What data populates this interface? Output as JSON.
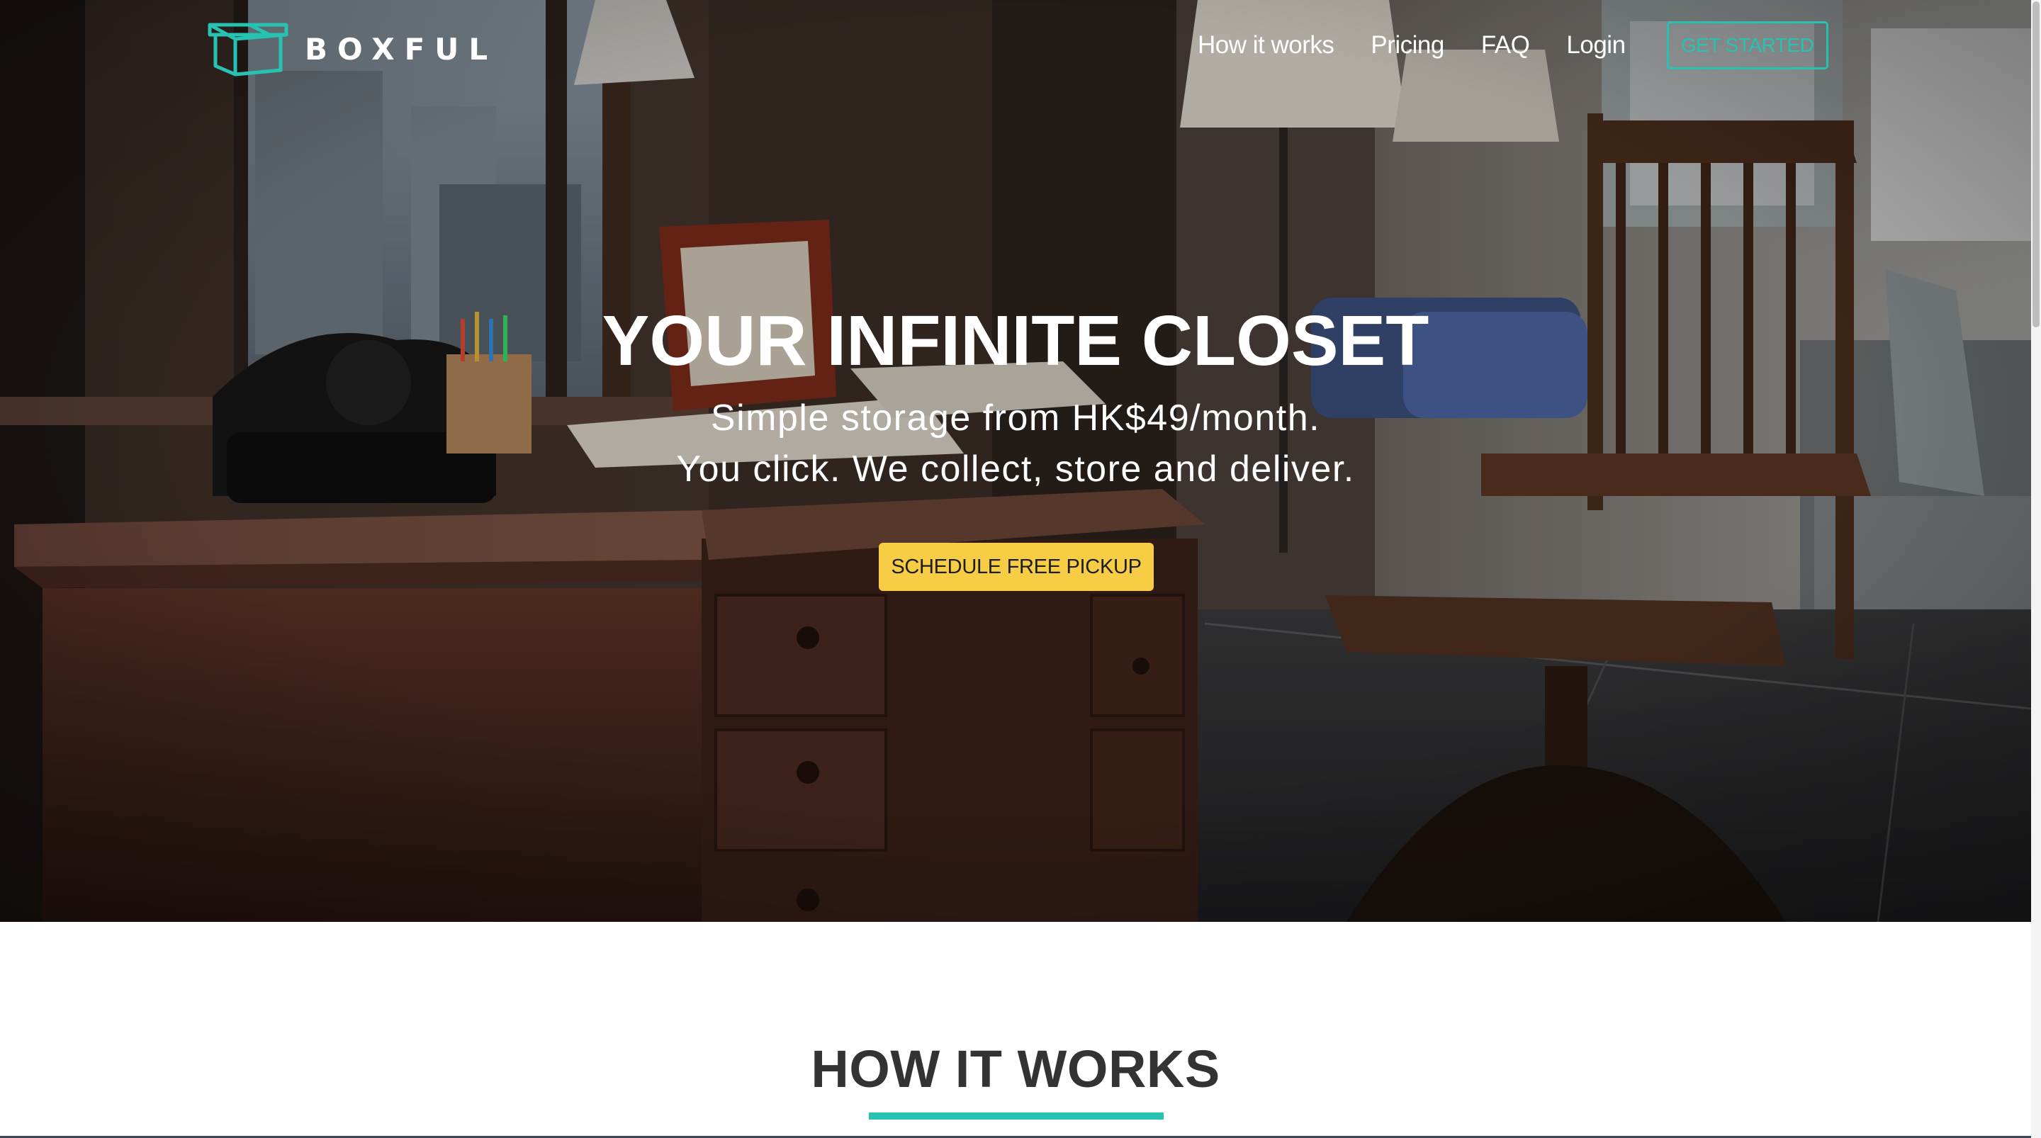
{
  "brand": {
    "name": "BOXFUL",
    "accent_color": "#27c2b2",
    "cta_color": "#f7cd46"
  },
  "nav": {
    "links": [
      "How it works",
      "Pricing",
      "FAQ",
      "Login"
    ],
    "cta_label": "GET STARTED"
  },
  "hero": {
    "title": "YOUR INFINITE CLOSET",
    "subtitle_line1": "Simple storage from HK$49/month.",
    "subtitle_line2": "You click. We collect, store and deliver.",
    "button_label": "SCHEDULE FREE PICKUP",
    "background": "home-office-photo"
  },
  "how_it_works": {
    "title": "HOW IT WORKS"
  }
}
